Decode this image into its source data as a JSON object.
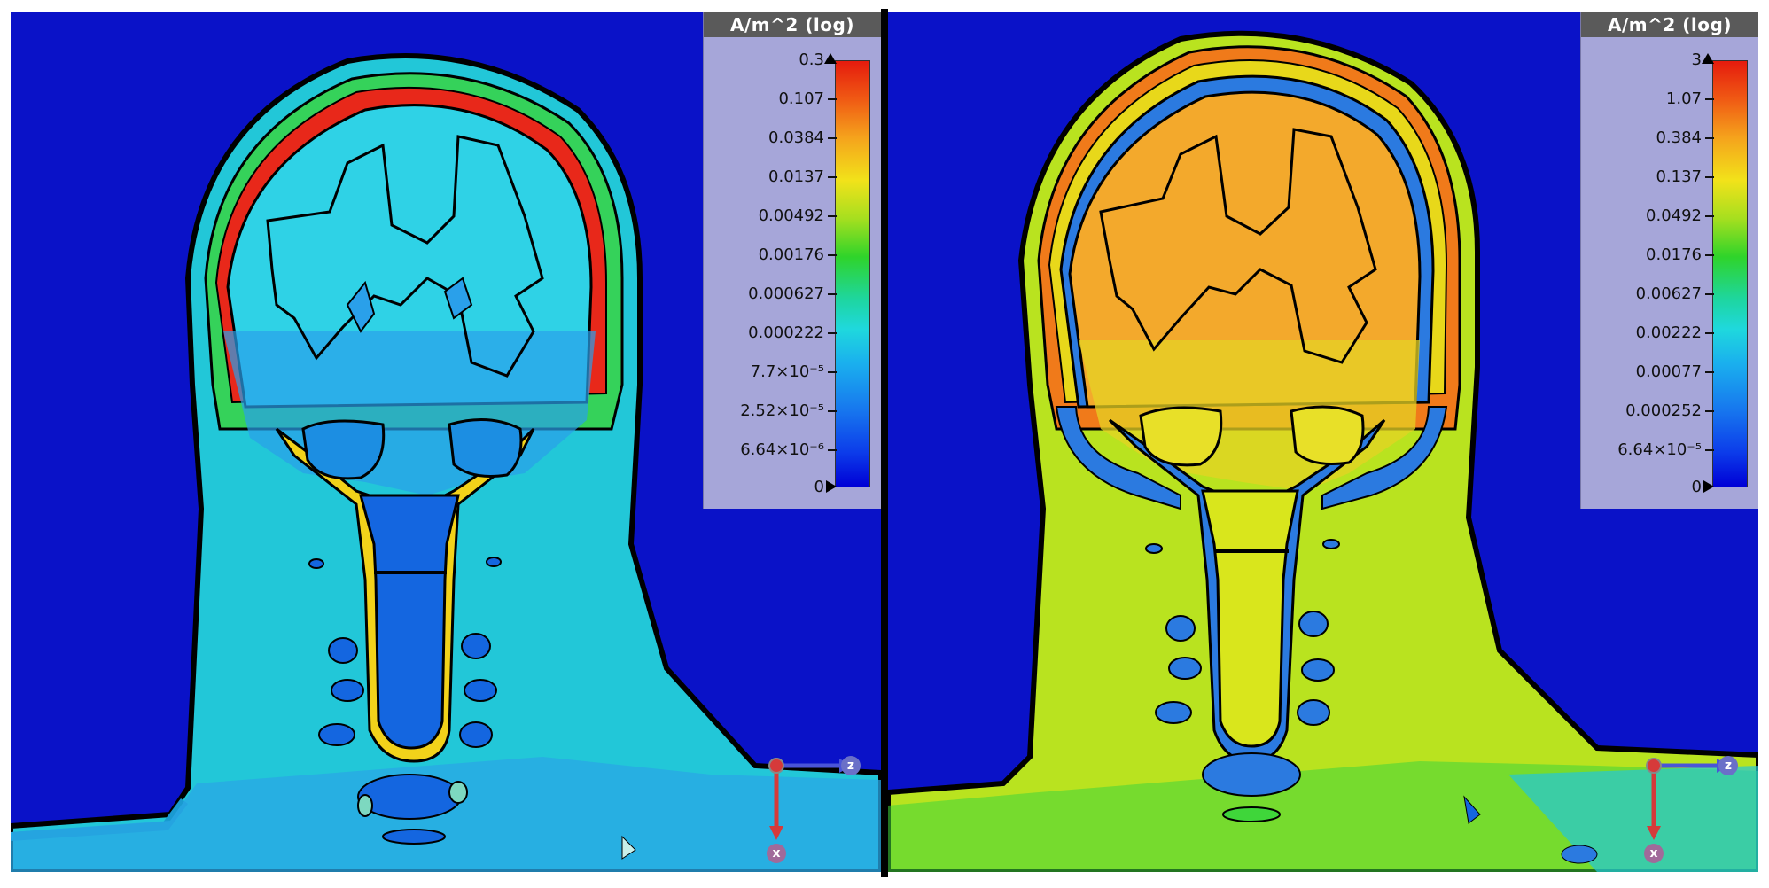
{
  "panels": [
    {
      "legend": {
        "title": "A/m^2 (log)",
        "ticks": [
          "0.3",
          "0.107",
          "0.0384",
          "0.0137",
          "0.00492",
          "0.00176",
          "0.000627",
          "0.000222",
          "7.7×10⁻⁵",
          "2.52×10⁻⁵",
          "6.64×10⁻⁶",
          "0"
        ]
      },
      "axes": {
        "horizontal": "z",
        "vertical": "x"
      }
    },
    {
      "legend": {
        "title": "A/m^2 (log)",
        "ticks": [
          "3",
          "1.07",
          "0.384",
          "0.137",
          "0.0492",
          "0.0176",
          "0.00627",
          "0.00222",
          "0.00077",
          "0.000252",
          "6.64×10⁻⁵",
          "0"
        ]
      },
      "axes": {
        "horizontal": "z",
        "vertical": "x"
      }
    }
  ],
  "colors": {
    "background": "#0a12c8",
    "left_skin": "#22c7d8",
    "left_brain": "#2fd2e6",
    "left_inner": "#1466e0",
    "right_skin": "#b9e31f",
    "right_brain": "#f3a92c",
    "right_outer": "#f07a1a",
    "right_inner": "#d9e61c",
    "csf_left": "#e8281a",
    "csf_right": "#2b7ae0"
  }
}
